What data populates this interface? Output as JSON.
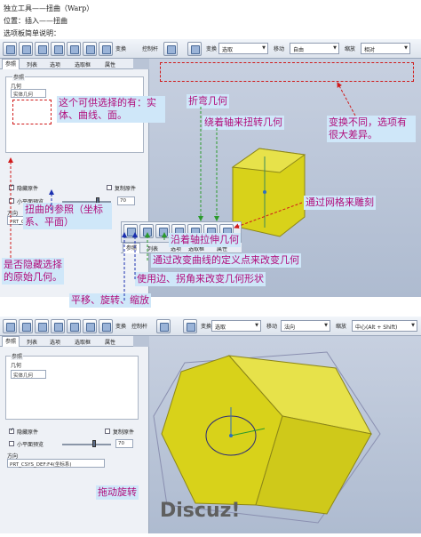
{
  "doc": {
    "line1": "独立工具——扭曲（Warp）",
    "line2": "位置：插入——扭曲",
    "line3": "选项板简单说明："
  },
  "toolbar": {
    "control_label": "控制杆",
    "transform_label": "变换",
    "transform_value": "选取",
    "move_label": "移动",
    "move_value_top": "自由",
    "move_value_bottom": "法向",
    "scale_label": "缩放",
    "scale_value_top": "相对",
    "scale_value_bottom": "中心(Alt + Shift)",
    "transform_icon_label": "变换"
  },
  "tabs": [
    "参照",
    "列表",
    "选项",
    "选取框",
    "属性"
  ],
  "side": {
    "refs_title": "参照",
    "geom_label": "几何",
    "solid_item": "实体几何",
    "hide_original": "隐藏原件",
    "copy_original": "复制原件",
    "small_plane": "小平面预览",
    "small_plane_value": "70",
    "direction_label": "方向",
    "direction_value": "PRT_CSYS_DEF:F4(坐标系)"
  },
  "annotations": {
    "a1": "这个可供选择的有：实体、曲线、面。",
    "a2": "折弯几何",
    "a3": "绕着轴来扭转几何",
    "a4": "变换不同，选项有很大差异。",
    "a5": "通过网格来雕刻",
    "a6": "扭曲的参照（坐标系、平面）",
    "a7": "沿着轴拉伸几何",
    "a8": "通过改变曲线的定义点来改变几何",
    "a9": "使用边、拐角来改变几何形状",
    "a10": "是否隐藏选择的原始几何。",
    "a11": "平移、旋转、缩放",
    "a12": "拖动旋转"
  },
  "watermark": "Discuz!",
  "colors": {
    "note_bg": "#cfe7f9",
    "note_text": "#b10c7a",
    "arrow_red": "#d01a1a",
    "arrow_green": "#2b9a2b",
    "arrow_blue": "#1a2fb0",
    "solid_yellow": "#d8d21a"
  }
}
